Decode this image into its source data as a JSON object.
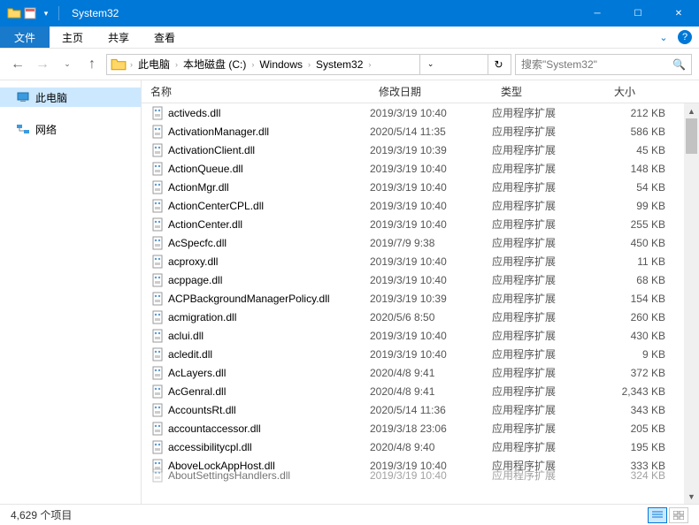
{
  "window": {
    "title": "System32",
    "qat_dropdown": "▾"
  },
  "ribbon": {
    "file": "文件",
    "tabs": [
      "主页",
      "共享",
      "查看"
    ],
    "expand": "⌄",
    "help": "?"
  },
  "nav": {
    "back": "←",
    "forward": "→",
    "recent": "⌄",
    "up": "↑",
    "crumbs": [
      "此电脑",
      "本地磁盘 (C:)",
      "Windows",
      "System32"
    ],
    "refresh": "↻",
    "search_placeholder": "搜索\"System32\""
  },
  "tree": {
    "this_pc": "此电脑",
    "network": "网络"
  },
  "columns": {
    "name": "名称",
    "date": "修改日期",
    "type": "类型",
    "size": "大小"
  },
  "files": [
    {
      "name": "AboutSettingsHandlers.dll",
      "date": "2019/3/19 10:40",
      "type": "应用程序扩展",
      "size": "324 KB",
      "cut": true
    },
    {
      "name": "AboveLockAppHost.dll",
      "date": "2019/3/19 10:40",
      "type": "应用程序扩展",
      "size": "333 KB"
    },
    {
      "name": "accessibilitycpl.dll",
      "date": "2020/4/8 9:40",
      "type": "应用程序扩展",
      "size": "195 KB"
    },
    {
      "name": "accountaccessor.dll",
      "date": "2019/3/18 23:06",
      "type": "应用程序扩展",
      "size": "205 KB"
    },
    {
      "name": "AccountsRt.dll",
      "date": "2020/5/14 11:36",
      "type": "应用程序扩展",
      "size": "343 KB"
    },
    {
      "name": "AcGenral.dll",
      "date": "2020/4/8 9:41",
      "type": "应用程序扩展",
      "size": "2,343 KB"
    },
    {
      "name": "AcLayers.dll",
      "date": "2020/4/8 9:41",
      "type": "应用程序扩展",
      "size": "372 KB"
    },
    {
      "name": "acledit.dll",
      "date": "2019/3/19 10:40",
      "type": "应用程序扩展",
      "size": "9 KB"
    },
    {
      "name": "aclui.dll",
      "date": "2019/3/19 10:40",
      "type": "应用程序扩展",
      "size": "430 KB"
    },
    {
      "name": "acmigration.dll",
      "date": "2020/5/6 8:50",
      "type": "应用程序扩展",
      "size": "260 KB"
    },
    {
      "name": "ACPBackgroundManagerPolicy.dll",
      "date": "2019/3/19 10:39",
      "type": "应用程序扩展",
      "size": "154 KB"
    },
    {
      "name": "acppage.dll",
      "date": "2019/3/19 10:40",
      "type": "应用程序扩展",
      "size": "68 KB"
    },
    {
      "name": "acproxy.dll",
      "date": "2019/3/19 10:40",
      "type": "应用程序扩展",
      "size": "11 KB"
    },
    {
      "name": "AcSpecfc.dll",
      "date": "2019/7/9 9:38",
      "type": "应用程序扩展",
      "size": "450 KB"
    },
    {
      "name": "ActionCenter.dll",
      "date": "2019/3/19 10:40",
      "type": "应用程序扩展",
      "size": "255 KB"
    },
    {
      "name": "ActionCenterCPL.dll",
      "date": "2019/3/19 10:40",
      "type": "应用程序扩展",
      "size": "99 KB"
    },
    {
      "name": "ActionMgr.dll",
      "date": "2019/3/19 10:40",
      "type": "应用程序扩展",
      "size": "54 KB"
    },
    {
      "name": "ActionQueue.dll",
      "date": "2019/3/19 10:40",
      "type": "应用程序扩展",
      "size": "148 KB"
    },
    {
      "name": "ActivationClient.dll",
      "date": "2019/3/19 10:39",
      "type": "应用程序扩展",
      "size": "45 KB"
    },
    {
      "name": "ActivationManager.dll",
      "date": "2020/5/14 11:35",
      "type": "应用程序扩展",
      "size": "586 KB"
    },
    {
      "name": "activeds.dll",
      "date": "2019/3/19 10:40",
      "type": "应用程序扩展",
      "size": "212 KB"
    }
  ],
  "status": {
    "count": "4,629 个项目"
  },
  "icons": {
    "min": "─",
    "max": "☐",
    "close": "✕",
    "search": "🔍"
  }
}
